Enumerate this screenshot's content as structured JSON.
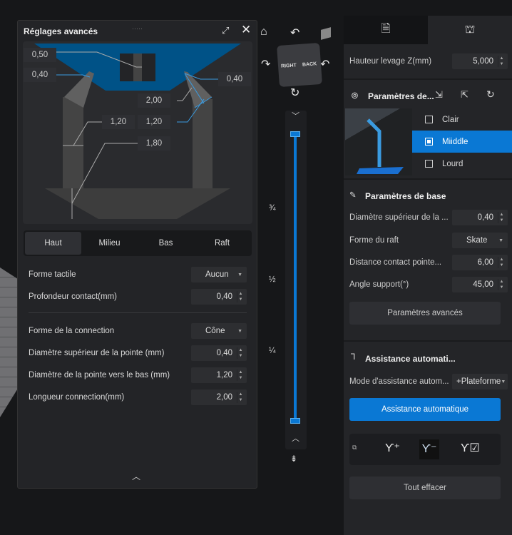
{
  "dialog": {
    "title": "Réglages avancés",
    "labels": {
      "top_contact": "0,50",
      "left_tip": "0,40",
      "right_tip": "0,40",
      "connection_len": "2,00",
      "pillar_dia": "1,20",
      "bottom_dia": "1,20",
      "base_height": "1,80"
    },
    "tabs": [
      {
        "label": "Haut",
        "active": true
      },
      {
        "label": "Milieu"
      },
      {
        "label": "Bas"
      },
      {
        "label": "Raft"
      }
    ],
    "fields": [
      {
        "label": "Forme tactile",
        "value": "Aucun",
        "type": "select"
      },
      {
        "label": "Profondeur contact(mm)",
        "value": "0,40",
        "type": "spin"
      },
      {
        "label": "Forme de la connection",
        "value": "Cône",
        "type": "select"
      },
      {
        "label": "Diamètre supérieur de la pointe (mm)",
        "value": "0,40",
        "type": "spin"
      },
      {
        "label": "Diamètre de la pointe vers le bas (mm)",
        "value": "1,20",
        "type": "spin"
      },
      {
        "label": "Longueur connection(mm)",
        "value": "2,00",
        "type": "spin"
      }
    ]
  },
  "viewport": {
    "cube_faces": {
      "right": "RIGHT",
      "back": "BACK"
    },
    "slider_ticks": [
      "¾",
      "½",
      "¼"
    ],
    "slider_value": 1.0
  },
  "right_panel": {
    "lift_label": "Hauteur levage Z(mm)",
    "lift_value": "5,000",
    "preset_title": "Paramètres de...",
    "presets": [
      {
        "label": "Clair"
      },
      {
        "label": "Miiddle",
        "selected": true
      },
      {
        "label": "Lourd"
      }
    ],
    "base_title": "Paramètres de base",
    "base_fields": [
      {
        "label": "Diamètre supérieur de la ...",
        "value": "0,40"
      },
      {
        "label": "Forme du raft",
        "value": "Skate"
      },
      {
        "label": "Distance contact pointe...",
        "value": "6,00"
      },
      {
        "label": "Angle support(°)",
        "value": "45,00"
      }
    ],
    "advanced_button": "Paramètres avancés",
    "auto_title": "Assistance automati...",
    "auto_mode_label": "Mode d'assistance autom...",
    "auto_mode_value": "+Plateforme",
    "auto_button": "Assistance automatique",
    "clear_button": "Tout effacer"
  },
  "colors": {
    "accent": "#0a78d4",
    "diagram_blue": "#005287"
  }
}
